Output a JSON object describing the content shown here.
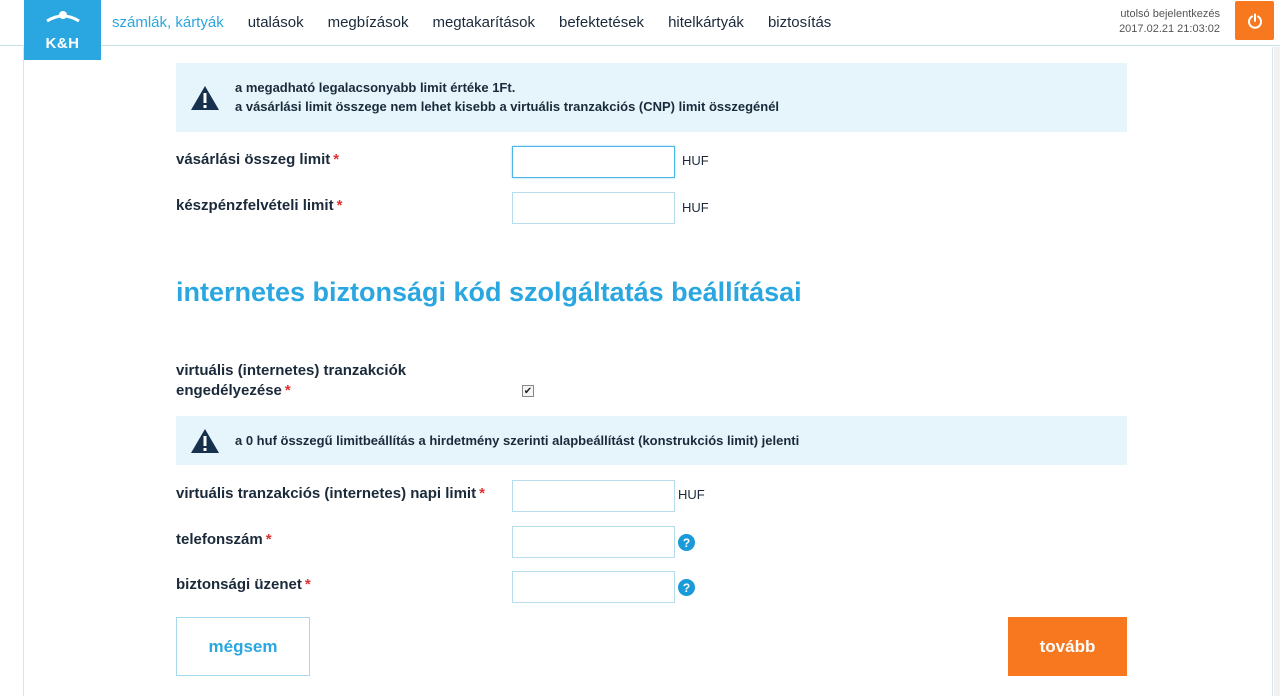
{
  "header": {
    "logo_text": "K&H",
    "nav": [
      {
        "label": "számlák, kártyák",
        "active": true
      },
      {
        "label": "utalások"
      },
      {
        "label": "megbízások"
      },
      {
        "label": "megtakarítások"
      },
      {
        "label": "befektetések"
      },
      {
        "label": "hitelkártyák"
      },
      {
        "label": "biztosítás"
      }
    ],
    "last_login_label": "utolsó bejelentkezés",
    "last_login_value": "2017.02.21 21:03:02",
    "logout_icon": "power-icon"
  },
  "info_box_1": {
    "line1": "a megadható legalacsonyabb limit értéke 1Ft.",
    "line2": "a vásárlási limit összege nem lehet kisebb a virtuális tranzakciós (CNP) limit összegénél",
    "icon": "warning-icon"
  },
  "limits": {
    "purchase_label": "vásárlási összeg limit",
    "purchase_value": "",
    "purchase_unit": "HUF",
    "cash_label": "készpénzfelvételi limit",
    "cash_value": "",
    "cash_unit": "HUF"
  },
  "section_title": "internetes biztonsági kód szolgáltatás beállításai",
  "virtual": {
    "enable_label_line1": "virtuális (internetes) tranzakciók",
    "enable_label_line2": "engedélyezése",
    "enabled": true
  },
  "info_box_2": {
    "text": "a 0 huf összegű limitbeállítás a hirdetmény szerinti alapbeállítást (konstrukciós limit) jelenti",
    "icon": "warning-icon"
  },
  "internet": {
    "daily_limit_label": "virtuális tranzakciós (internetes) napi limit",
    "daily_limit_value": "",
    "daily_limit_unit": "HUF",
    "phone_label": "telefonszám",
    "phone_value": "",
    "security_msg_label": "biztonsági üzenet",
    "security_msg_value": "",
    "help_glyph": "?"
  },
  "required_mark": "*",
  "checkbox_glyph": "✔",
  "buttons": {
    "cancel": "mégsem",
    "next": "tovább"
  },
  "colors": {
    "accent": "#2aa7e0",
    "orange": "#f7781e",
    "info_bg": "#e5f5fb",
    "text": "#1b2a3a",
    "required": "#e03030"
  }
}
